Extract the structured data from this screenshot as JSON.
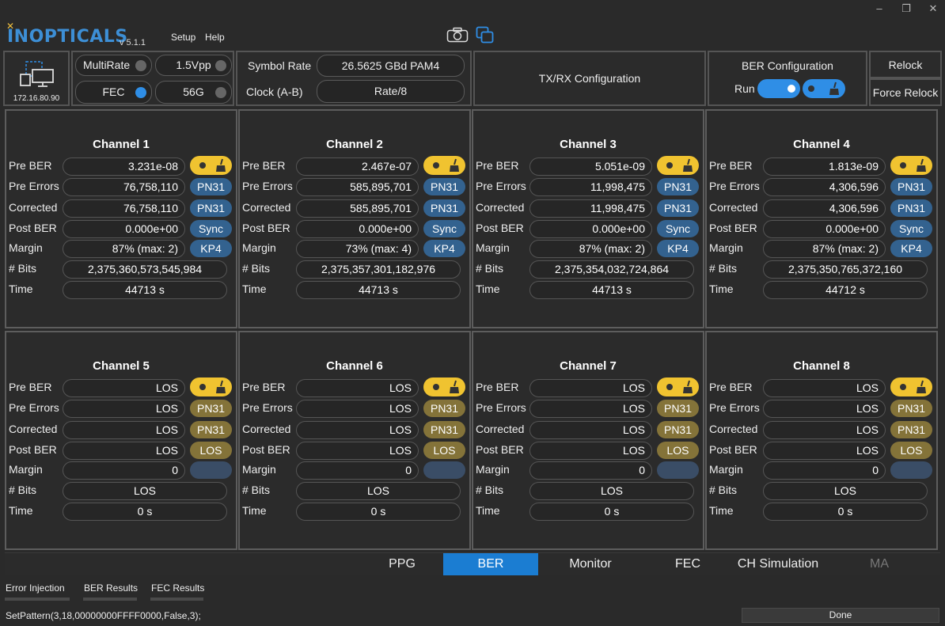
{
  "app": {
    "logo_text": "INOPTICALS",
    "version": "v 5.1.1",
    "menu": [
      "Setup",
      "Help"
    ],
    "window_buttons": [
      "–",
      "❐",
      "✕"
    ]
  },
  "device": {
    "ip": "172.16.80.90"
  },
  "toggles": {
    "multirate": "MultiRate",
    "vpp": "1.5Vpp",
    "fec": "FEC",
    "rate": "56G"
  },
  "symbol": {
    "symbol_rate_label": "Symbol Rate",
    "symbol_rate_value": "26.5625 GBd PAM4",
    "clock_label": "Clock (A-B)",
    "clock_value": "Rate/8"
  },
  "txrx": {
    "label": "TX/RX Configuration"
  },
  "ber_config": {
    "title": "BER Configuration",
    "run_label": "Run"
  },
  "relock": {
    "relock": "Relock",
    "force_relock": "Force Relock"
  },
  "row_labels": [
    "Pre BER",
    "Pre Errors",
    "Corrected",
    "Post BER",
    "Margin",
    "# Bits",
    "Time"
  ],
  "channels": [
    {
      "name": "Channel 1",
      "pre_ber": "3.231e-08",
      "pre_errors": "76,758,110",
      "corrected": "76,758,110",
      "post_ber": "0.000e+00",
      "margin": "87% (max: 2)",
      "bits": "2,375,360,573,545,984",
      "time": "44713 s",
      "tags": [
        "PN31",
        "PN31",
        "Sync",
        "KP4"
      ],
      "state": "ok"
    },
    {
      "name": "Channel 2",
      "pre_ber": "2.467e-07",
      "pre_errors": "585,895,701",
      "corrected": "585,895,701",
      "post_ber": "0.000e+00",
      "margin": "73% (max: 4)",
      "bits": "2,375,357,301,182,976",
      "time": "44713 s",
      "tags": [
        "PN31",
        "PN31",
        "Sync",
        "KP4"
      ],
      "state": "ok"
    },
    {
      "name": "Channel 3",
      "pre_ber": "5.051e-09",
      "pre_errors": "11,998,475",
      "corrected": "11,998,475",
      "post_ber": "0.000e+00",
      "margin": "87% (max: 2)",
      "bits": "2,375,354,032,724,864",
      "time": "44713 s",
      "tags": [
        "PN31",
        "PN31",
        "Sync",
        "KP4"
      ],
      "state": "ok"
    },
    {
      "name": "Channel 4",
      "pre_ber": "1.813e-09",
      "pre_errors": "4,306,596",
      "corrected": "4,306,596",
      "post_ber": "0.000e+00",
      "margin": "87% (max: 2)",
      "bits": "2,375,350,765,372,160",
      "time": "44712 s",
      "tags": [
        "PN31",
        "PN31",
        "Sync",
        "KP4"
      ],
      "state": "ok"
    },
    {
      "name": "Channel 5",
      "pre_ber": "LOS",
      "pre_errors": "LOS",
      "corrected": "LOS",
      "post_ber": "LOS",
      "margin": "0",
      "bits": "LOS",
      "time": "0 s",
      "tags": [
        "PN31",
        "PN31",
        "LOS",
        ""
      ],
      "state": "los"
    },
    {
      "name": "Channel 6",
      "pre_ber": "LOS",
      "pre_errors": "LOS",
      "corrected": "LOS",
      "post_ber": "LOS",
      "margin": "0",
      "bits": "LOS",
      "time": "0 s",
      "tags": [
        "PN31",
        "PN31",
        "LOS",
        ""
      ],
      "state": "los"
    },
    {
      "name": "Channel 7",
      "pre_ber": "LOS",
      "pre_errors": "LOS",
      "corrected": "LOS",
      "post_ber": "LOS",
      "margin": "0",
      "bits": "LOS",
      "time": "0 s",
      "tags": [
        "PN31",
        "PN31",
        "LOS",
        ""
      ],
      "state": "los"
    },
    {
      "name": "Channel 8",
      "pre_ber": "LOS",
      "pre_errors": "LOS",
      "corrected": "LOS",
      "post_ber": "LOS",
      "margin": "0",
      "bits": "LOS",
      "time": "0 s",
      "tags": [
        "PN31",
        "PN31",
        "LOS",
        ""
      ],
      "state": "los"
    }
  ],
  "tabs": [
    "PPG",
    "BER",
    "Monitor",
    "FEC",
    "CH Simulation",
    "MA"
  ],
  "active_tab": "BER",
  "subtabs": [
    "Error Injection",
    "BER Results",
    "FEC Results"
  ],
  "status": {
    "command": "SetPattern(3,18,00000000FFFF0000,False,3);",
    "state": "Done"
  },
  "colors": {
    "accent": "#1b7dd2",
    "toggle_yellow": "#f0c330",
    "tag_blue": "#33628f",
    "tag_olive": "#847339"
  }
}
